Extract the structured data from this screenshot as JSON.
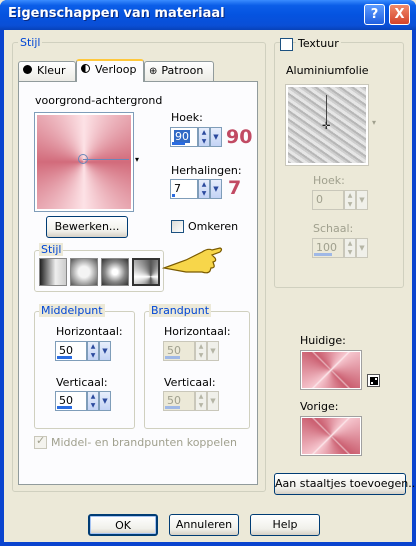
{
  "window": {
    "title": "Eigenschappen van materiaal",
    "help_glyph": "?",
    "close_glyph": "X"
  },
  "stijl_group": {
    "title": "Stijl"
  },
  "tabs": [
    {
      "label": "Kleur",
      "icon": "solid-circle-icon"
    },
    {
      "label": "Verloop",
      "icon": "half-circle-icon",
      "active": true
    },
    {
      "label": "Patroon",
      "icon": "pattern-icon"
    }
  ],
  "gradient": {
    "name": "voorgrond-achtergrond",
    "dropdown_glyph": "▾"
  },
  "angle": {
    "label": "Hoek:",
    "value": "90",
    "annotation": "90"
  },
  "repeats": {
    "label": "Herhalingen:",
    "value": "7",
    "annotation": "7"
  },
  "edit_button": "Bewerken...",
  "invert": {
    "label": "Omkeren",
    "checked": false
  },
  "style_sub": {
    "title": "Stijl",
    "options": [
      "linear",
      "rectangular",
      "sunburst",
      "radial"
    ]
  },
  "middelpunt": {
    "title": "Middelpunt",
    "horizontal_label": "Horizontaal:",
    "horizontal_value": "50",
    "vertical_label": "Verticaal:",
    "vertical_value": "50"
  },
  "brandpunt": {
    "title": "Brandpunt",
    "horizontal_label": "Horizontaal:",
    "horizontal_value": "50",
    "vertical_label": "Verticaal:",
    "vertical_value": "50"
  },
  "link_points": {
    "label": "Middel- en brandpunten koppelen",
    "checked": true
  },
  "texture": {
    "label": "Textuur",
    "checked": false,
    "name": "Aluminiumfolie",
    "angle_label": "Hoek:",
    "angle_value": "0",
    "scale_label": "Schaal:",
    "scale_value": "100"
  },
  "current": {
    "label": "Huidige:"
  },
  "previous": {
    "label": "Vorige:"
  },
  "add_swatch_button": "Aan staaltjes toevoegen...",
  "footer": {
    "ok": "OK",
    "cancel": "Annuleren",
    "help": "Help"
  },
  "colors": {
    "accent_annotation": "#c14a63",
    "group_title": "#0046d5",
    "title_bar": "#0553e0"
  }
}
